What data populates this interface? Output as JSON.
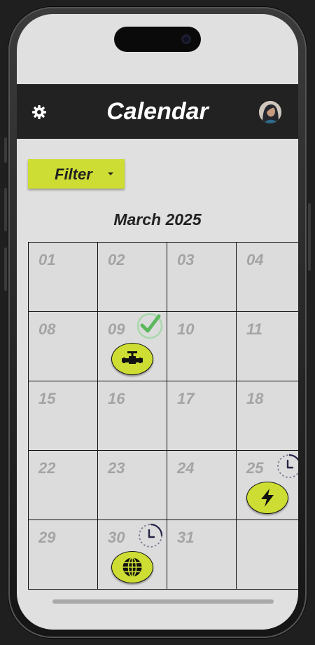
{
  "header": {
    "title": "Calendar"
  },
  "filter": {
    "label": "Filter"
  },
  "calendar": {
    "month_label": "March 2025",
    "days": [
      {
        "num": "01"
      },
      {
        "num": "02"
      },
      {
        "num": "03"
      },
      {
        "num": "04"
      },
      {
        "num": "08"
      },
      {
        "num": "09",
        "status": "completed",
        "event": "pipeline-valve"
      },
      {
        "num": "10"
      },
      {
        "num": "11"
      },
      {
        "num": "15"
      },
      {
        "num": "16"
      },
      {
        "num": "17"
      },
      {
        "num": "18"
      },
      {
        "num": "22"
      },
      {
        "num": "23"
      },
      {
        "num": "24"
      },
      {
        "num": "25",
        "status": "pending",
        "event": "lightning-bolt"
      },
      {
        "num": "29"
      },
      {
        "num": "30",
        "status": "pending",
        "event": "globe"
      },
      {
        "num": "31"
      },
      {
        "num": ""
      }
    ]
  },
  "colors": {
    "accent": "#cddd33",
    "header_bg": "#222222",
    "screen_bg": "#e0e0e0",
    "check": "#5cb85c"
  }
}
